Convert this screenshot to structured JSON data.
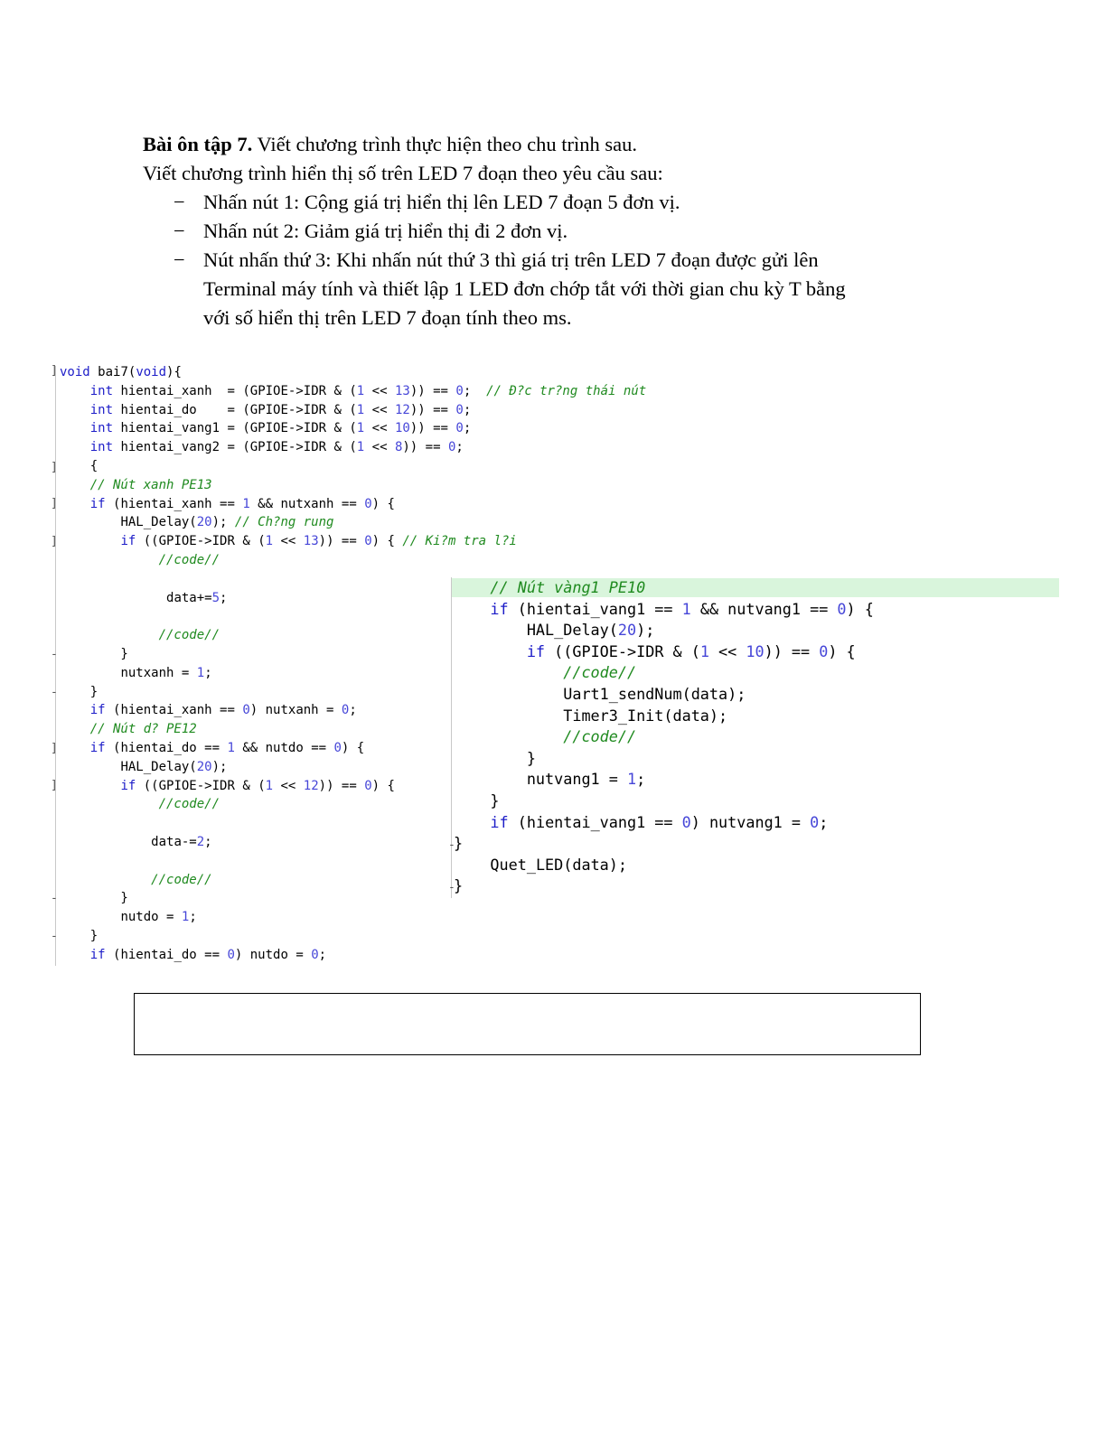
{
  "exercise": {
    "title_bold": "Bài ôn tập 7.",
    "title_rest": " Viết chương trình thực hiện theo chu trình sau.",
    "intro": "Viết chương trình hiển thị số trên LED 7 đoạn theo yêu cầu sau:",
    "bullet_mark": "−",
    "bullets": [
      "Nhấn nút 1: Cộng giá trị hiển thị lên LED 7 đoạn 5 đơn vị.",
      "Nhấn nút 2: Giảm giá trị hiển thị đi 2 đơn vị.",
      "Nút nhấn thứ 3: Khi nhấn nút thứ 3 thì giá trị trên LED 7 đoạn được gửi lên",
      "Terminal máy tính và thiết lập 1 LED đơn chớp tắt với thời gian chu kỳ T bằng",
      "với số hiển thị trên LED 7 đoạn tính theo ms."
    ]
  },
  "code_left": [
    "void bai7(void){",
    "    int hientai_xanh  = (GPIOE->IDR & (1 << 13)) == 0;  // Ð?c tr?ng thái nút",
    "    int hientai_do    = (GPIOE->IDR & (1 << 12)) == 0;",
    "    int hientai_vang1 = (GPIOE->IDR & (1 << 10)) == 0;",
    "    int hientai_vang2 = (GPIOE->IDR & (1 << 8)) == 0;",
    "    {",
    "    // Nút xanh PE13",
    "    if (hientai_xanh == 1 && nutxanh == 0) {",
    "        HAL_Delay(20); // Ch?ng rung",
    "        if ((GPIOE->IDR & (1 << 13)) == 0) { // Ki?m tra l?i",
    "             //code//",
    "",
    "              data+=5;",
    "",
    "             //code//",
    "        }",
    "        nutxanh = 1;",
    "    }",
    "    if (hientai_xanh == 0) nutxanh = 0;",
    "    // Nút d? PE12",
    "    if (hientai_do == 1 && nutdo == 0) {",
    "        HAL_Delay(20);",
    "        if ((GPIOE->IDR & (1 << 12)) == 0) {",
    "             //code//",
    "",
    "            data-=2;",
    "",
    "            //code//",
    "        }",
    "        nutdo = 1;",
    "    }",
    "    if (hientai_do == 0) nutdo = 0;"
  ],
  "code_right": [
    "    // Nút vàng1 PE10",
    "    if (hientai_vang1 == 1 && nutvang1 == 0) {",
    "        HAL_Delay(20);",
    "        if ((GPIOE->IDR & (1 << 10)) == 0) {",
    "            //code//",
    "            Uart1_sendNum(data);",
    "            Timer3_Init(data);",
    "            //code//",
    "        }",
    "        nutvang1 = 1;",
    "    }",
    "    if (hientai_vang1 == 0) nutvang1 = 0;",
    "}",
    "    Quet_LED(data);",
    "}"
  ],
  "fold_markers": {
    "left": "]",
    "end": "-"
  },
  "colors": {
    "keyword": "#1d1dc8",
    "comment": "#1f8a1f",
    "number": "#4646d8",
    "highlight": "#d9f5dc"
  }
}
